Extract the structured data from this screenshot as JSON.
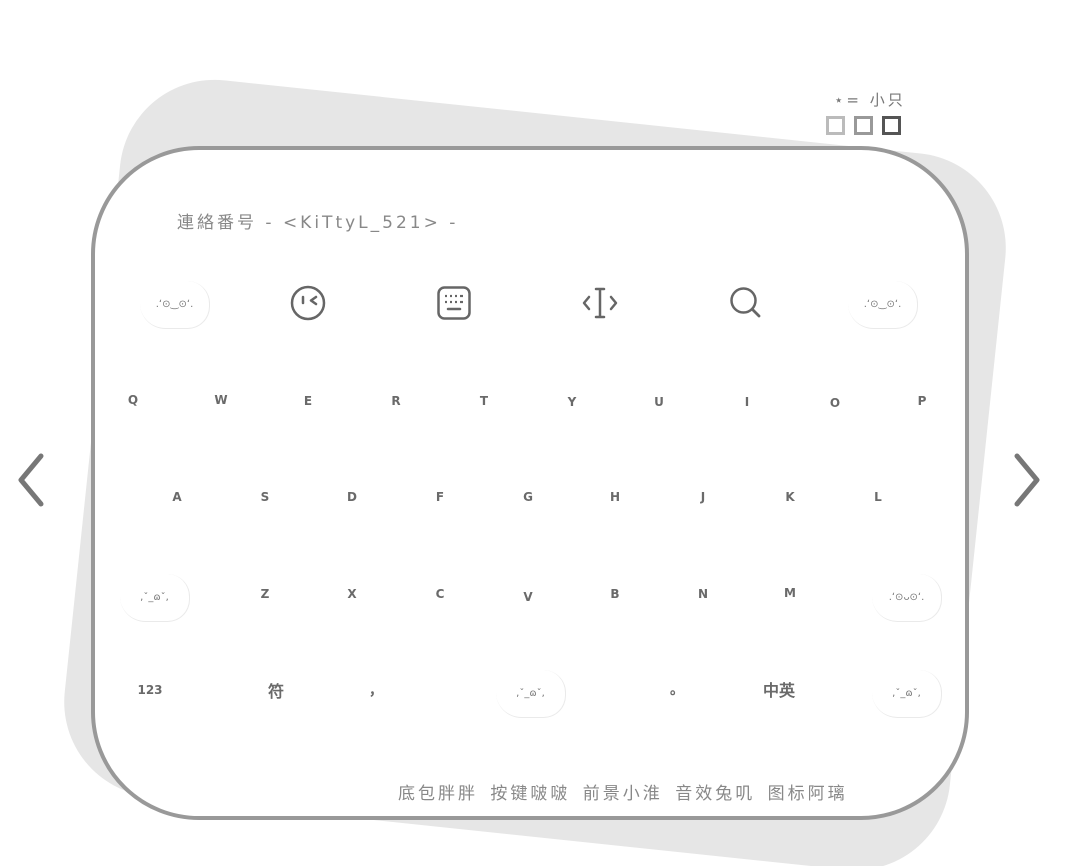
{
  "author_line": "⋆= 小只",
  "contact": "連絡番号 - <KiTtyL_521> -",
  "function_row": {
    "left_kaomoji": ".ʻ⊙‿⊙ʻ.",
    "right_kaomoji": ".ʻ⊙‿⊙ʻ.",
    "icons": [
      "emoji-face-icon",
      "keyboard-icon",
      "cursor-icon",
      "search-icon"
    ]
  },
  "row1": [
    "Q",
    "W",
    "E",
    "R",
    "T",
    "Y",
    "U",
    "I",
    "O",
    "P"
  ],
  "row2": [
    "A",
    "S",
    "D",
    "F",
    "G",
    "H",
    "J",
    "K",
    "L"
  ],
  "row3": {
    "left_kaomoji": ",ˇ_ɷˇ,",
    "keys": [
      "Z",
      "X",
      "C",
      "V",
      "B",
      "N",
      "M"
    ],
    "right_kaomoji": ".ʻ⊙ᴗ⊙ʻ."
  },
  "row4": {
    "numbers": "123",
    "symbols": "符",
    "comma": "，",
    "space_kaomoji": ",ˇ_ɷˇ,",
    "period": "。",
    "lang": "中英",
    "enter_kaomoji": ",ˇ_ɷˇ,"
  },
  "credits": "底包胖胖 按键啵啵 前景小淮 音效兔叽 图标阿璃",
  "colors": {
    "frame": "#999999",
    "background_shape": "#e6e6e6",
    "key_text": "#6a6a6a"
  }
}
